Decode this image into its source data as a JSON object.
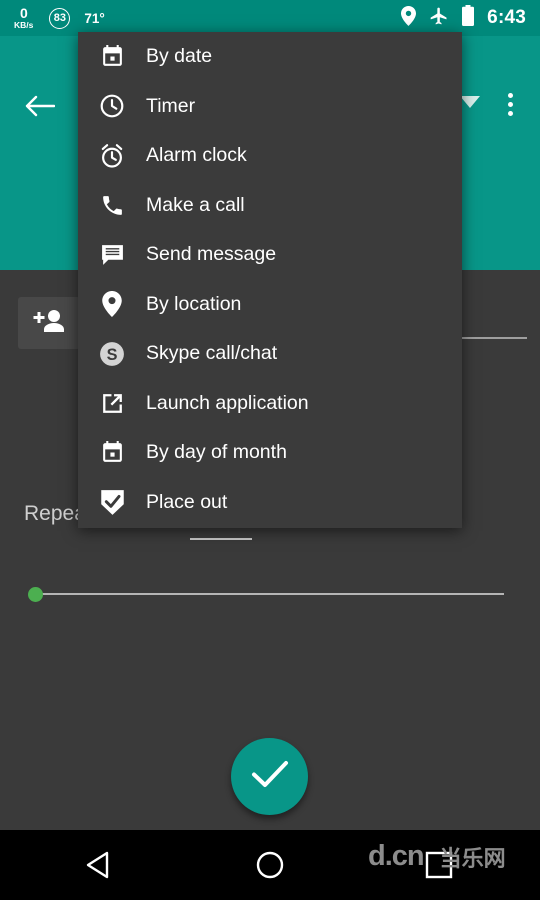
{
  "status_bar": {
    "net_speed_value": "0",
    "net_speed_unit": "KB/s",
    "badge_value": "83",
    "temperature": "71°",
    "location_icon": "location-pin-icon",
    "airplane_icon": "airplane-mode-icon",
    "battery_icon": "battery-icon",
    "clock": "6:43"
  },
  "app_bar": {
    "back_icon": "back-arrow-icon",
    "dropdown_icon": "chevron-down-icon",
    "overflow_icon": "overflow-menu-icon",
    "background_color": "#089688"
  },
  "content": {
    "add_person_icon": "add-person-icon",
    "repeat_label": "Repeat",
    "slider_value": 0,
    "slider_thumb_color": "#4caf50",
    "fab_icon": "check-icon",
    "fab_color": "#089688"
  },
  "popup_menu": {
    "background_color": "#3b3b3b",
    "items": [
      {
        "label": "By date",
        "icon": "calendar-icon"
      },
      {
        "label": "Timer",
        "icon": "clock-icon"
      },
      {
        "label": "Alarm clock",
        "icon": "alarm-clock-icon"
      },
      {
        "label": "Make a call",
        "icon": "phone-icon"
      },
      {
        "label": "Send message",
        "icon": "message-icon"
      },
      {
        "label": "By location",
        "icon": "location-pin-icon"
      },
      {
        "label": "Skype call/chat",
        "icon": "skype-icon"
      },
      {
        "label": "Launch application",
        "icon": "launch-external-icon"
      },
      {
        "label": "By day of month",
        "icon": "calendar-icon"
      },
      {
        "label": "Place out",
        "icon": "check-shield-icon"
      }
    ]
  },
  "nav_bar": {
    "back_icon": "nav-back-triangle-icon",
    "home_icon": "nav-home-circle-icon",
    "recents_icon": "nav-recents-square-icon"
  },
  "watermark": {
    "latin": "d.cn",
    "chinese": "当乐网"
  }
}
